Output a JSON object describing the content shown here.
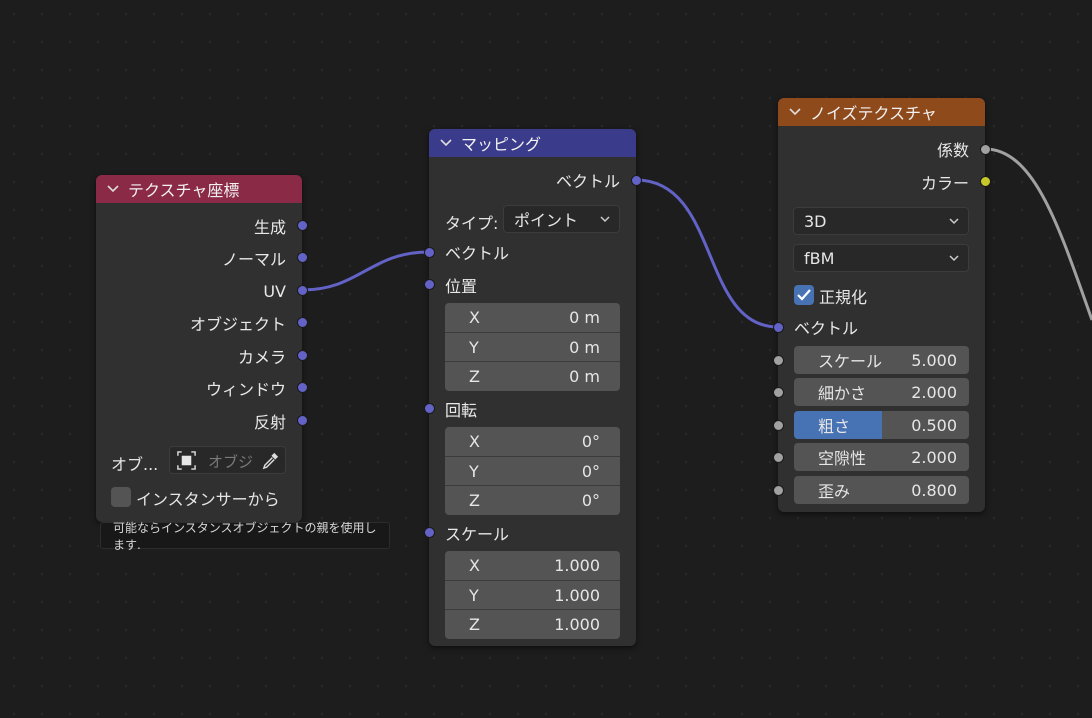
{
  "colors": {
    "background": "#1d1d1d",
    "node_body": "#303030",
    "header_texcoord": "#8a2a47",
    "header_mapping": "#3b3b8c",
    "header_noise": "#8f4a1c",
    "socket_vector": "#6363c7",
    "socket_float": "#a1a1a1",
    "socket_color": "#c7c729",
    "accent": "#4772b3"
  },
  "texcoord_node": {
    "title": "テクスチャ座標",
    "outputs": [
      "生成",
      "ノーマル",
      "UV",
      "オブジェクト",
      "カメラ",
      "ウィンドウ",
      "反射"
    ],
    "object_label": "オブ...",
    "object_placeholder": "オブジ",
    "from_instancer_label": "インスタンサーから",
    "from_instancer_checked": false
  },
  "tooltip": {
    "text": "可能ならインスタンスオブジェクトの親を使用します."
  },
  "mapping_node": {
    "title": "マッピング",
    "output_vector": "ベクトル",
    "type_label": "タイプ:",
    "type_value": "ポイント",
    "input_vector": "ベクトル",
    "location": {
      "label": "位置",
      "rows": [
        {
          "axis": "X",
          "value": "0 m"
        },
        {
          "axis": "Y",
          "value": "0 m"
        },
        {
          "axis": "Z",
          "value": "0 m"
        }
      ]
    },
    "rotation": {
      "label": "回転",
      "rows": [
        {
          "axis": "X",
          "value": "0°"
        },
        {
          "axis": "Y",
          "value": "0°"
        },
        {
          "axis": "Z",
          "value": "0°"
        }
      ]
    },
    "scale": {
      "label": "スケール",
      "rows": [
        {
          "axis": "X",
          "value": "1.000"
        },
        {
          "axis": "Y",
          "value": "1.000"
        },
        {
          "axis": "Z",
          "value": "1.000"
        }
      ]
    }
  },
  "noise_node": {
    "title": "ノイズテクスチャ",
    "output_fac": "係数",
    "output_color": "カラー",
    "dimensions": "3D",
    "noise_type": "fBM",
    "normalize_label": "正規化",
    "normalize_checked": true,
    "input_vector": "ベクトル",
    "inputs": [
      {
        "label": "スケール",
        "value": "5.000"
      },
      {
        "label": "細かさ",
        "value": "2.000"
      },
      {
        "label": "粗さ",
        "value": "0.500",
        "fill": 0.5
      },
      {
        "label": "空隙性",
        "value": "2.000"
      },
      {
        "label": "歪み",
        "value": "0.800"
      }
    ]
  }
}
